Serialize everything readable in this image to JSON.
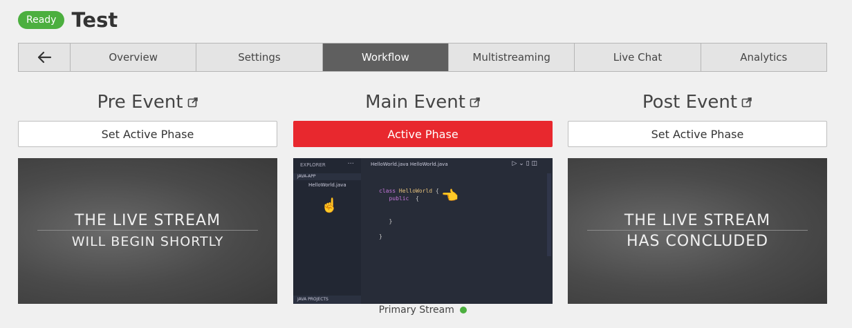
{
  "header": {
    "status_badge": "Ready",
    "title": "Test"
  },
  "tabs": [
    {
      "label": "Overview"
    },
    {
      "label": "Settings"
    },
    {
      "label": "Workflow",
      "active": true
    },
    {
      "label": "Multistreaming"
    },
    {
      "label": "Live Chat"
    },
    {
      "label": "Analytics"
    }
  ],
  "phases": [
    {
      "title": "Pre Event",
      "button": "Set Active Phase",
      "thumb_line1": "THE LIVE STREAM",
      "thumb_line2": "WILL BEGIN SHORTLY"
    },
    {
      "title": "Main Event",
      "button": "Active Phase",
      "active": true,
      "stream_label": "Primary Stream"
    },
    {
      "title": "Post Event",
      "button": "Set Active Phase",
      "thumb_line1": "THE LIVE STREAM",
      "thumb_line2": "HAS CONCLUDED"
    }
  ],
  "editor": {
    "explorer": "EXPLORER",
    "project": "JAVA-APP",
    "file": "HelloWorld.java",
    "tab": "HelloWorld.java HelloWorld.java",
    "java_projects": "JAVA PROJECTS",
    "code_line1_kw": "class",
    "code_line1_cls": "HelloWorld",
    "code_line2": "public"
  },
  "colors": {
    "active_red": "#e8282e",
    "ready_green": "#4caf3f",
    "active_tab": "#5f5f5f"
  },
  "icons": {
    "back": "arrow-left-icon",
    "external": "external-link-icon",
    "status": "green-dot-icon"
  }
}
